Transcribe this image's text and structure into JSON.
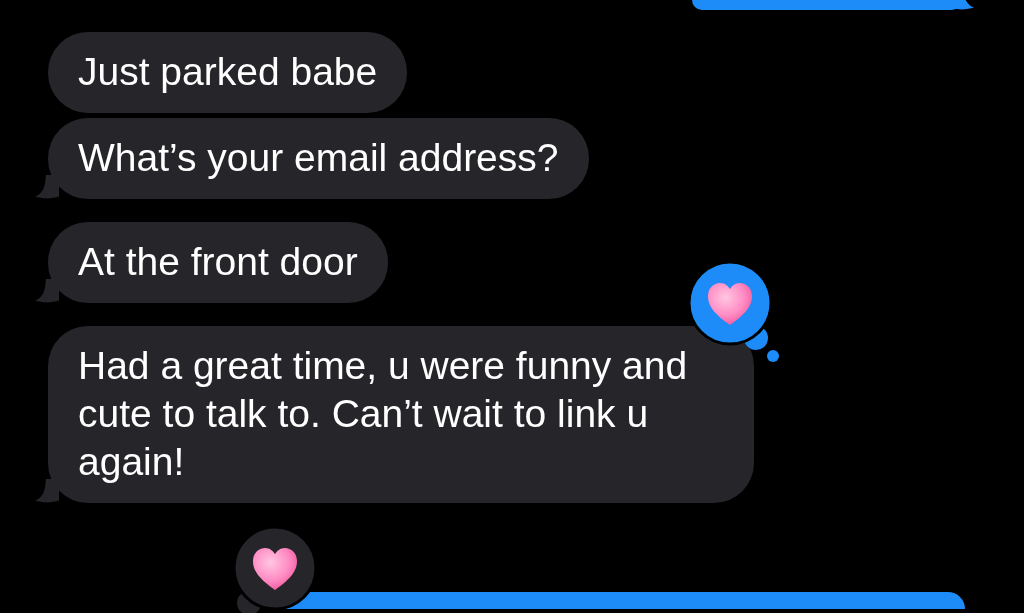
{
  "messages": [
    {
      "kind": "sent",
      "tail": true
    },
    {
      "kind": "received",
      "text": "Just parked babe",
      "tail": false
    },
    {
      "kind": "received",
      "text": "What’s your email address?",
      "tail": true
    },
    {
      "kind": "received",
      "text": "At the front door",
      "tail": true
    },
    {
      "kind": "received",
      "text": "Had a great time, u were funny and cute to talk to. Can’t wait to link u again!",
      "tail": true,
      "reaction": {
        "kind": "heart",
        "mine": true
      }
    },
    {
      "kind": "sent",
      "tail": false,
      "reaction": {
        "kind": "heart",
        "mine": false
      }
    }
  ]
}
